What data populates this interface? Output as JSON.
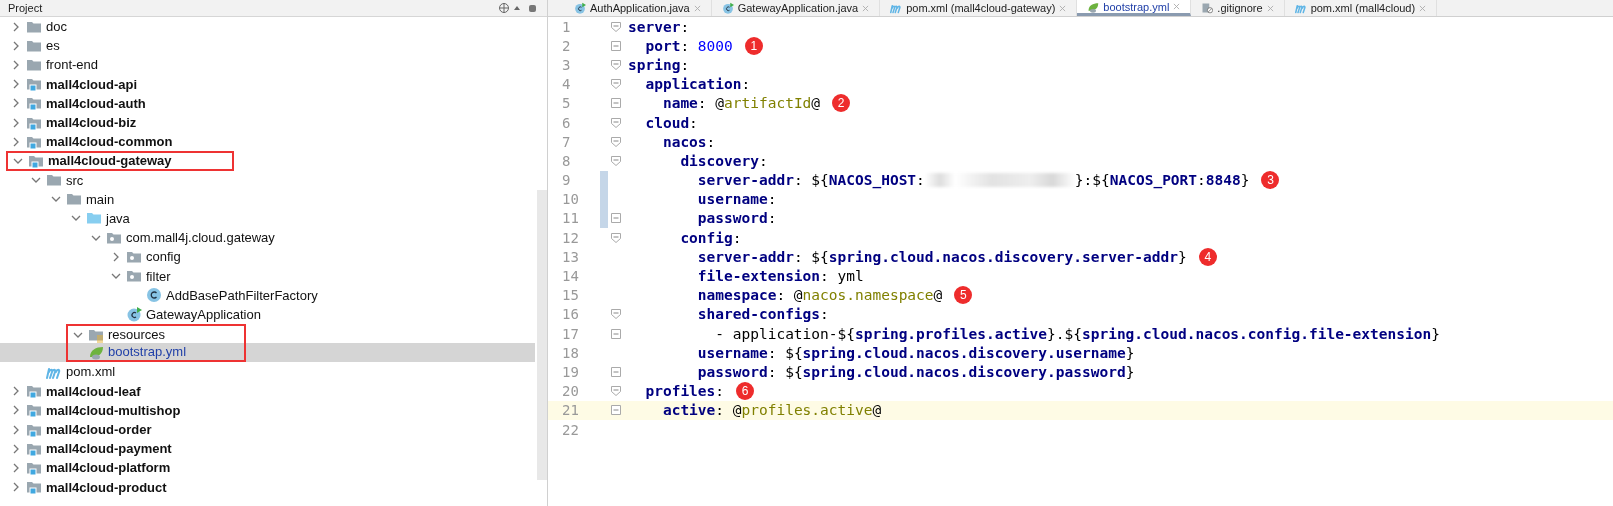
{
  "project_panel": {
    "title": "Project",
    "tree": [
      {
        "label": "doc",
        "kind": "folder",
        "expanded": false,
        "selected": false,
        "boxed": false
      },
      {
        "label": "es",
        "kind": "folder",
        "expanded": false,
        "selected": false,
        "boxed": false
      },
      {
        "label": "front-end",
        "kind": "folder",
        "expanded": false,
        "selected": false,
        "boxed": false
      },
      {
        "label": "mall4cloud-api",
        "kind": "module",
        "expanded": false,
        "selected": false,
        "boxed": false
      },
      {
        "label": "mall4cloud-auth",
        "kind": "module",
        "expanded": false,
        "selected": false,
        "boxed": false
      },
      {
        "label": "mall4cloud-biz",
        "kind": "module",
        "expanded": false,
        "selected": false,
        "boxed": false
      },
      {
        "label": "mall4cloud-common",
        "kind": "module",
        "expanded": false,
        "selected": false,
        "boxed": false
      },
      {
        "label": "mall4cloud-gateway",
        "kind": "module",
        "expanded": true,
        "selected": false,
        "boxed": true,
        "children": [
          {
            "label": "src",
            "kind": "folder",
            "expanded": true,
            "selected": false,
            "boxed": false,
            "children": [
              {
                "label": "main",
                "kind": "folder",
                "expanded": true,
                "selected": false,
                "boxed": false,
                "children": [
                  {
                    "label": "java",
                    "kind": "source",
                    "expanded": true,
                    "selected": false,
                    "boxed": false,
                    "children": [
                      {
                        "label": "com.mall4j.cloud.gateway",
                        "kind": "package",
                        "expanded": true,
                        "selected": false,
                        "boxed": false,
                        "children": [
                          {
                            "label": "config",
                            "kind": "package",
                            "expanded": false,
                            "selected": false,
                            "boxed": false
                          },
                          {
                            "label": "filter",
                            "kind": "package",
                            "expanded": true,
                            "selected": false,
                            "boxed": false,
                            "children": [
                              {
                                "label": "AddBasePathFilterFactory",
                                "kind": "class",
                                "selected": false,
                                "boxed": false
                              }
                            ]
                          },
                          {
                            "label": "GatewayApplication",
                            "kind": "appclass",
                            "selected": false,
                            "boxed": false
                          }
                        ]
                      }
                    ]
                  },
                  {
                    "label": "resources",
                    "kind": "resources",
                    "expanded": true,
                    "selected": false,
                    "boxed": true,
                    "children": [
                      {
                        "label": "bootstrap.yml",
                        "kind": "yaml",
                        "selected": true,
                        "boxed": true
                      }
                    ]
                  }
                ]
              }
            ]
          },
          {
            "label": "pom.xml",
            "kind": "maven",
            "selected": false,
            "boxed": false
          }
        ]
      },
      {
        "label": "mall4cloud-leaf",
        "kind": "module",
        "expanded": false,
        "selected": false,
        "boxed": false
      },
      {
        "label": "mall4cloud-multishop",
        "kind": "module",
        "expanded": false,
        "selected": false,
        "boxed": false
      },
      {
        "label": "mall4cloud-order",
        "kind": "module",
        "expanded": false,
        "selected": false,
        "boxed": false
      },
      {
        "label": "mall4cloud-payment",
        "kind": "module",
        "expanded": false,
        "selected": false,
        "boxed": false
      },
      {
        "label": "mall4cloud-platform",
        "kind": "module",
        "expanded": false,
        "selected": false,
        "boxed": false
      },
      {
        "label": "mall4cloud-product",
        "kind": "module",
        "expanded": false,
        "selected": false,
        "boxed": false
      }
    ]
  },
  "editor": {
    "tabs": [
      {
        "label": "AuthApplication.java",
        "kind": "appclass",
        "selected": false
      },
      {
        "label": "GatewayApplication.java",
        "kind": "appclass",
        "selected": false
      },
      {
        "label": "pom.xml (mall4cloud-gateway)",
        "kind": "maven",
        "selected": false
      },
      {
        "label": "bootstrap.yml",
        "kind": "yaml",
        "selected": true
      },
      {
        "label": ".gitignore",
        "kind": "ignored",
        "selected": false
      },
      {
        "label": "pom.xml (mall4cloud)",
        "kind": "maven",
        "selected": false
      }
    ],
    "lines": [
      {
        "number": "1",
        "kind": "start",
        "changed": false,
        "current": false,
        "tokens": [
          {
            "kind": "key",
            "text": "server"
          },
          {
            "kind": "punct",
            "text": ":"
          }
        ]
      },
      {
        "number": "2",
        "kind": "end",
        "changed": false,
        "current": false,
        "badge": "1",
        "tokens": [
          {
            "kind": "key",
            "text": "  port"
          },
          {
            "kind": "punct",
            "text": ": "
          },
          {
            "kind": "num",
            "text": "8000"
          }
        ]
      },
      {
        "number": "3",
        "kind": "start",
        "changed": false,
        "current": false,
        "tokens": [
          {
            "kind": "key",
            "text": "spring"
          },
          {
            "kind": "punct",
            "text": ":"
          }
        ]
      },
      {
        "number": "4",
        "kind": "start",
        "changed": false,
        "current": false,
        "tokens": [
          {
            "kind": "key",
            "text": "  application"
          },
          {
            "kind": "punct",
            "text": ":"
          }
        ]
      },
      {
        "number": "5",
        "kind": "end",
        "changed": false,
        "current": false,
        "badge": "2",
        "tokens": [
          {
            "kind": "key",
            "text": "    name"
          },
          {
            "kind": "punct",
            "text": ": @"
          },
          {
            "kind": "macro",
            "text": "artifactId"
          },
          {
            "kind": "punct",
            "text": "@"
          }
        ]
      },
      {
        "number": "6",
        "kind": "start",
        "changed": false,
        "current": false,
        "tokens": [
          {
            "kind": "key",
            "text": "  cloud"
          },
          {
            "kind": "punct",
            "text": ":"
          }
        ]
      },
      {
        "number": "7",
        "kind": "start",
        "changed": false,
        "current": false,
        "tokens": [
          {
            "kind": "key",
            "text": "    nacos"
          },
          {
            "kind": "punct",
            "text": ":"
          }
        ]
      },
      {
        "number": "8",
        "kind": "start",
        "changed": false,
        "current": false,
        "tokens": [
          {
            "kind": "key",
            "text": "      discovery"
          },
          {
            "kind": "punct",
            "text": ":"
          }
        ]
      },
      {
        "number": "9",
        "kind": "plain",
        "changed": true,
        "current": false,
        "badge": "3",
        "tokens": [
          {
            "kind": "key",
            "text": "        server-addr"
          },
          {
            "kind": "punct",
            "text": ": ${"
          },
          {
            "kind": "ref",
            "text": "NACOS_HOST"
          },
          {
            "kind": "punct",
            "text": ":"
          },
          {
            "kind": "redacted"
          },
          {
            "kind": "punct",
            "text": "}:${"
          },
          {
            "kind": "ref",
            "text": "NACOS_PORT"
          },
          {
            "kind": "punct",
            "text": ":"
          },
          {
            "kind": "ref",
            "text": "8848"
          },
          {
            "kind": "punct",
            "text": "}"
          }
        ]
      },
      {
        "number": "10",
        "kind": "plain",
        "changed": true,
        "current": false,
        "tokens": [
          {
            "kind": "key",
            "text": "        username"
          },
          {
            "kind": "punct",
            "text": ":"
          }
        ]
      },
      {
        "number": "11",
        "kind": "end",
        "changed": true,
        "current": false,
        "tokens": [
          {
            "kind": "key",
            "text": "        password"
          },
          {
            "kind": "punct",
            "text": ":"
          }
        ]
      },
      {
        "number": "12",
        "kind": "start",
        "changed": false,
        "current": false,
        "tokens": [
          {
            "kind": "key",
            "text": "      config"
          },
          {
            "kind": "punct",
            "text": ":"
          }
        ]
      },
      {
        "number": "13",
        "kind": "plain",
        "changed": false,
        "current": false,
        "badge": "4",
        "tokens": [
          {
            "kind": "key",
            "text": "        server-addr"
          },
          {
            "kind": "punct",
            "text": ": ${"
          },
          {
            "kind": "ref",
            "text": "spring.cloud.nacos.discovery.server-addr"
          },
          {
            "kind": "punct",
            "text": "}"
          }
        ]
      },
      {
        "number": "14",
        "kind": "plain",
        "changed": false,
        "current": false,
        "tokens": [
          {
            "kind": "key",
            "text": "        file-extension"
          },
          {
            "kind": "punct",
            "text": ": yml"
          }
        ]
      },
      {
        "number": "15",
        "kind": "plain",
        "changed": false,
        "current": false,
        "badge": "5",
        "tokens": [
          {
            "kind": "key",
            "text": "        namespace"
          },
          {
            "kind": "punct",
            "text": ": @"
          },
          {
            "kind": "macro",
            "text": "nacos.namespace"
          },
          {
            "kind": "punct",
            "text": "@"
          }
        ]
      },
      {
        "number": "16",
        "kind": "start",
        "changed": false,
        "current": false,
        "tokens": [
          {
            "kind": "key",
            "text": "        shared-configs"
          },
          {
            "kind": "punct",
            "text": ":"
          }
        ]
      },
      {
        "number": "17",
        "kind": "end",
        "changed": false,
        "current": false,
        "tokens": [
          {
            "kind": "punct",
            "text": "          - application-${"
          },
          {
            "kind": "ref",
            "text": "spring.profiles.active"
          },
          {
            "kind": "punct",
            "text": "}.${"
          },
          {
            "kind": "ref",
            "text": "spring.cloud.nacos.config.file-extension"
          },
          {
            "kind": "punct",
            "text": "}"
          }
        ]
      },
      {
        "number": "18",
        "kind": "plain",
        "changed": false,
        "current": false,
        "tokens": [
          {
            "kind": "key",
            "text": "        username"
          },
          {
            "kind": "punct",
            "text": ": ${"
          },
          {
            "kind": "ref",
            "text": "spring.cloud.nacos.discovery.username"
          },
          {
            "kind": "punct",
            "text": "}"
          }
        ]
      },
      {
        "number": "19",
        "kind": "end",
        "changed": false,
        "current": false,
        "tokens": [
          {
            "kind": "key",
            "text": "        password"
          },
          {
            "kind": "punct",
            "text": ": ${"
          },
          {
            "kind": "ref",
            "text": "spring.cloud.nacos.discovery.password"
          },
          {
            "kind": "punct",
            "text": "}"
          }
        ]
      },
      {
        "number": "20",
        "kind": "start",
        "changed": false,
        "current": false,
        "badge": "6",
        "tokens": [
          {
            "kind": "key",
            "text": "  profiles"
          },
          {
            "kind": "punct",
            "text": ":"
          }
        ]
      },
      {
        "number": "21",
        "kind": "end",
        "changed": false,
        "current": true,
        "tokens": [
          {
            "kind": "key",
            "text": "    active"
          },
          {
            "kind": "punct",
            "text": ": @"
          },
          {
            "kind": "macro",
            "text": "profiles.active"
          },
          {
            "kind": "punct",
            "text": "@"
          }
        ]
      },
      {
        "number": "22",
        "kind": "plain",
        "changed": false,
        "current": false
      }
    ]
  }
}
